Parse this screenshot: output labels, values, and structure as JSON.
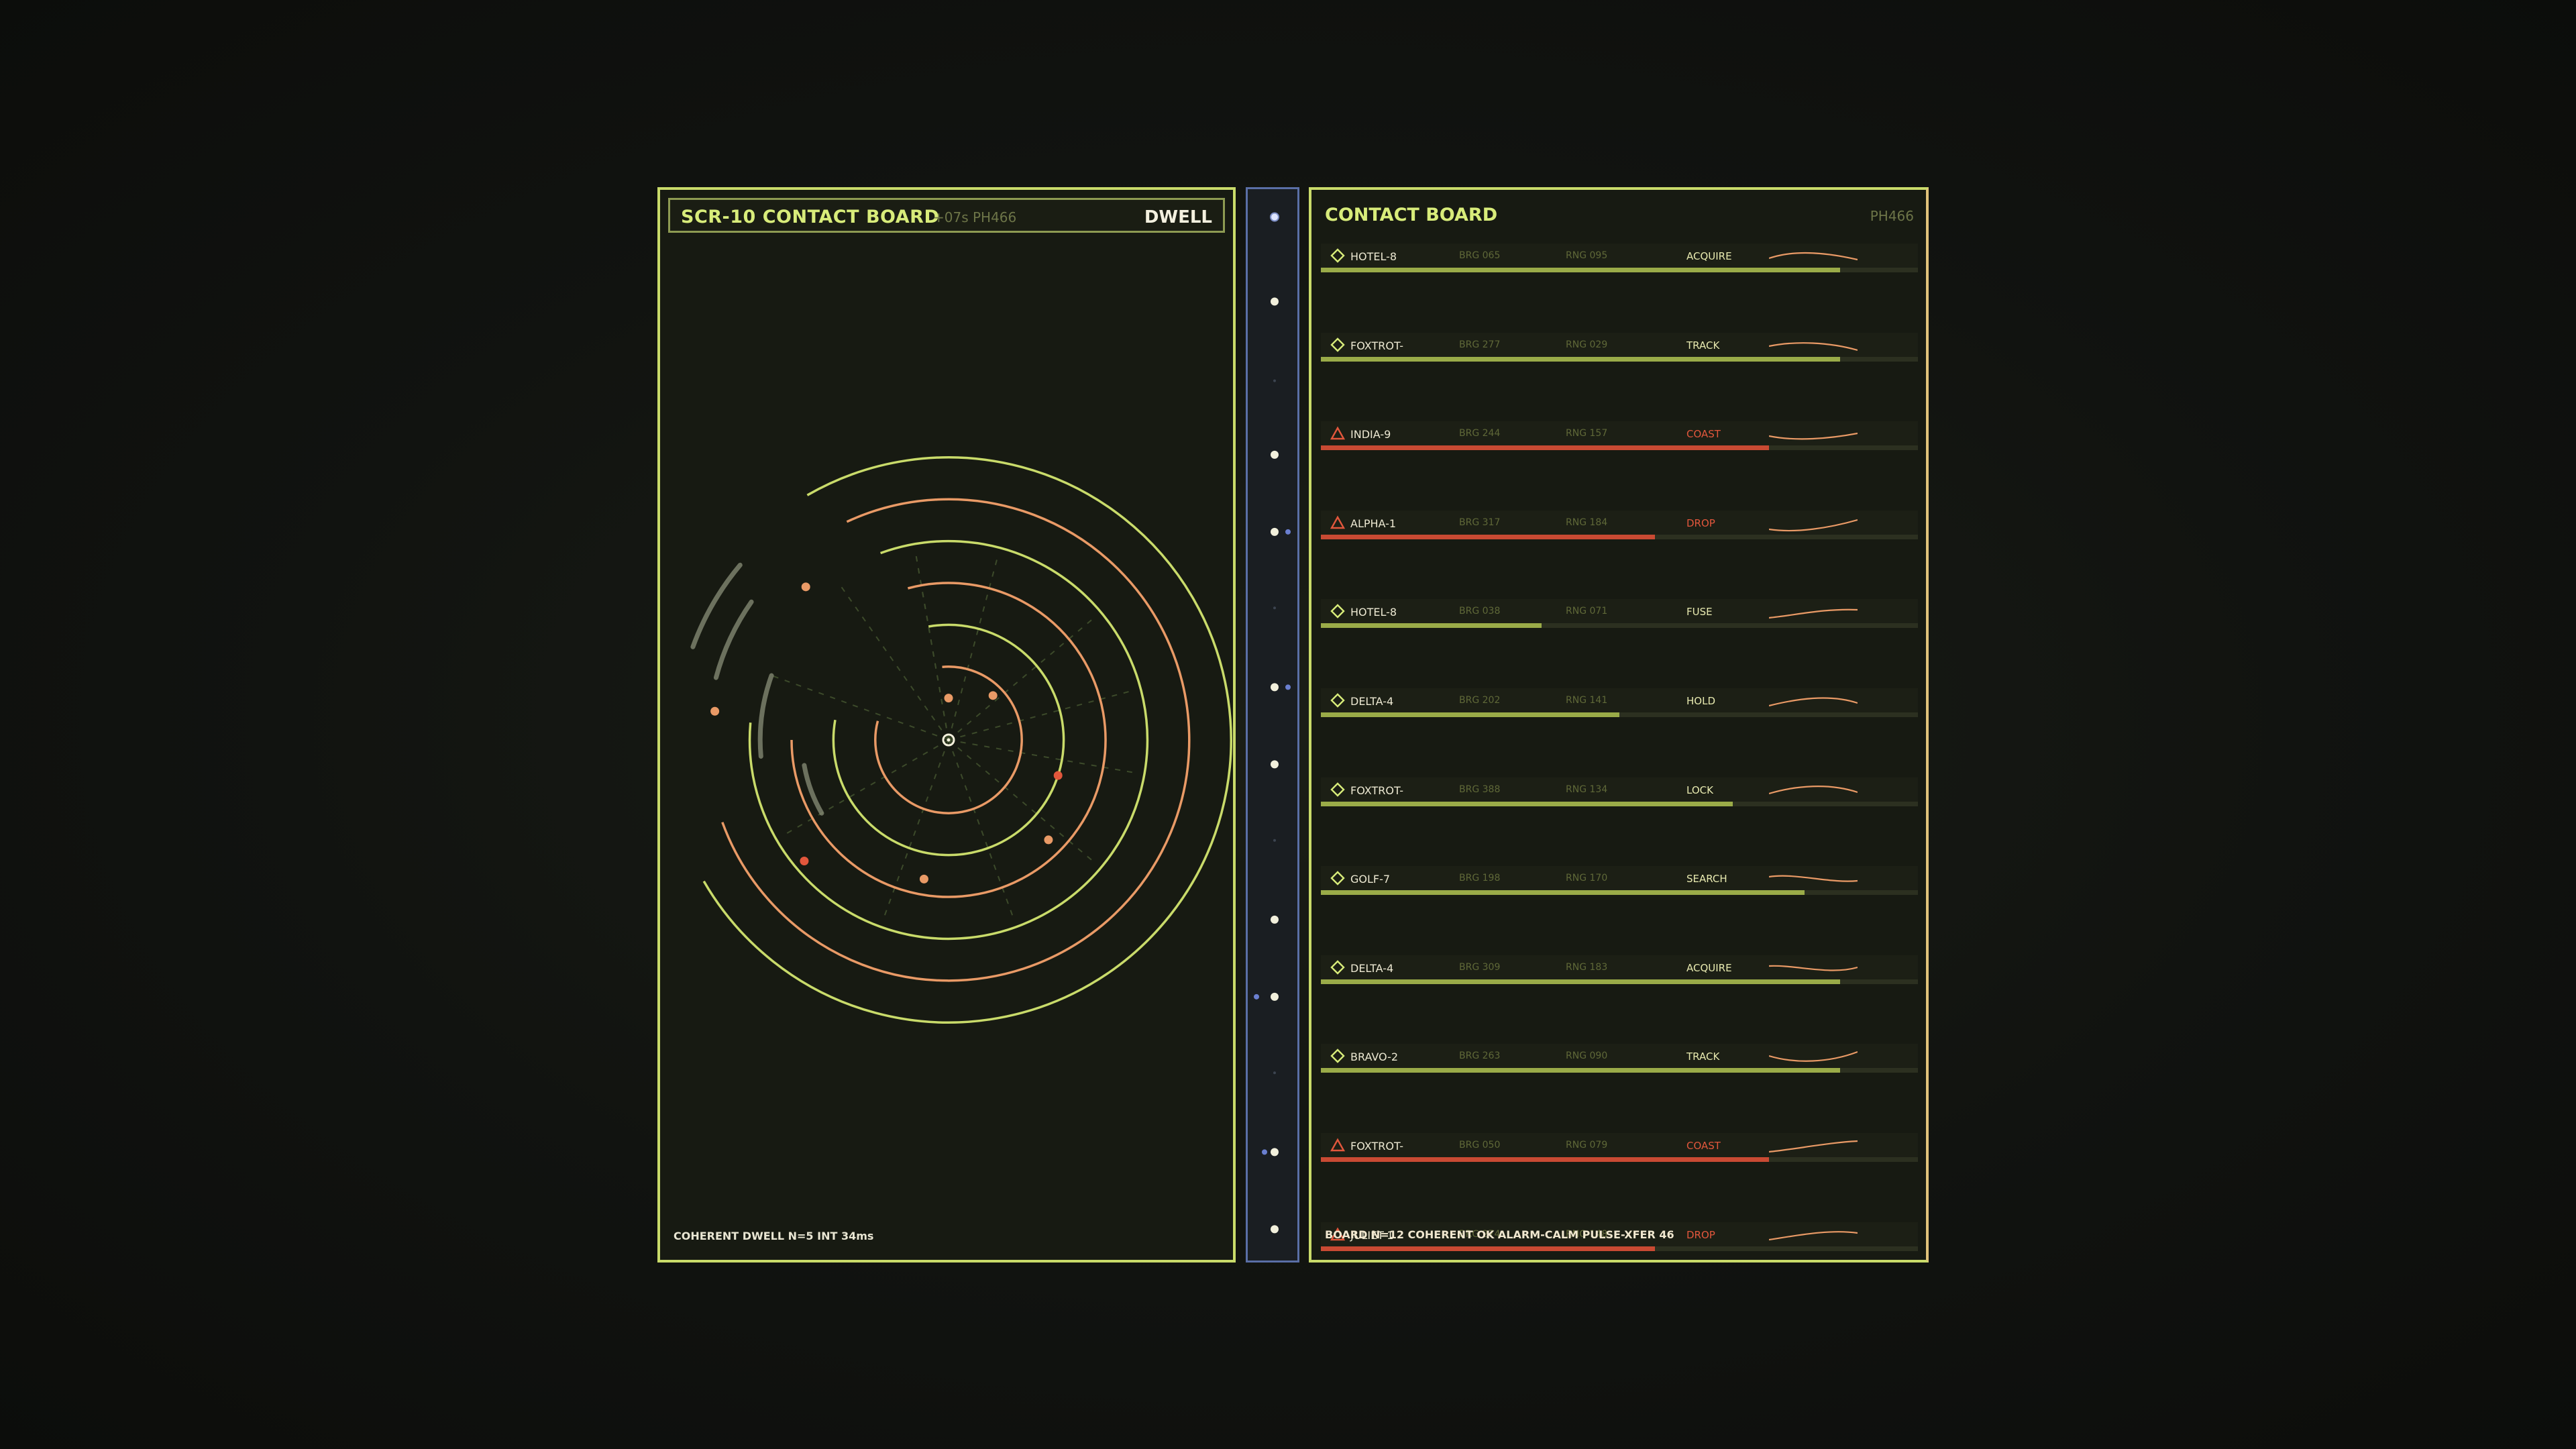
{
  "colors": {
    "accent": "#d8ec7a",
    "lime": "#c9db6a",
    "orange": "#e99a66",
    "red": "#e2573c",
    "blue": "#5a6fa6",
    "gray": "#8a8f78"
  },
  "left": {
    "title": "SCR-10  CONTACT BOARD",
    "title_sub": "+07s  PH466",
    "mode": "DWELL",
    "footer": "COHERENT DWELL  N=5  INT 34ms"
  },
  "right": {
    "title": "CONTACT BOARD",
    "code": "PH466",
    "footer": "BOARD N=12  COHERENT OK  ALARM-CALM  PULSE-XFER 46",
    "rows": [
      {
        "name": "HOTEL-8",
        "brg": "BRG 065",
        "rng": "RNG 095",
        "state": "ACQUIRE",
        "icon": "diamond",
        "alert": false,
        "level": 0.87
      },
      {
        "name": "FOXTROT-",
        "brg": "BRG 277",
        "rng": "RNG 029",
        "state": "TRACK",
        "icon": "diamond",
        "alert": false,
        "level": 0.87
      },
      {
        "name": "INDIA-9",
        "brg": "BRG 244",
        "rng": "RNG 157",
        "state": "COAST",
        "icon": "triangle",
        "alert": true,
        "level": 0.75
      },
      {
        "name": "ALPHA-1",
        "brg": "BRG 317",
        "rng": "RNG 184",
        "state": "DROP",
        "icon": "triangle",
        "alert": true,
        "level": 0.56
      },
      {
        "name": "HOTEL-8",
        "brg": "BRG 038",
        "rng": "RNG 071",
        "state": "FUSE",
        "icon": "diamond",
        "alert": false,
        "level": 0.37
      },
      {
        "name": "DELTA-4",
        "brg": "BRG 202",
        "rng": "RNG 141",
        "state": "HOLD",
        "icon": "diamond",
        "alert": false,
        "level": 0.5
      },
      {
        "name": "FOXTROT-",
        "brg": "BRG 388",
        "rng": "RNG 134",
        "state": "LOCK",
        "icon": "diamond",
        "alert": false,
        "level": 0.69
      },
      {
        "name": "GOLF-7",
        "brg": "BRG 198",
        "rng": "RNG 170",
        "state": "SEARCH",
        "icon": "diamond",
        "alert": false,
        "level": 0.81
      },
      {
        "name": "DELTA-4",
        "brg": "BRG 309",
        "rng": "RNG 183",
        "state": "ACQUIRE",
        "icon": "diamond",
        "alert": false,
        "level": 0.87
      },
      {
        "name": "BRAVO-2",
        "brg": "BRG 263",
        "rng": "RNG 090",
        "state": "TRACK",
        "icon": "diamond",
        "alert": false,
        "level": 0.87
      },
      {
        "name": "FOXTROT-",
        "brg": "BRG 050",
        "rng": "RNG 079",
        "state": "COAST",
        "icon": "triangle",
        "alert": true,
        "level": 0.75
      },
      {
        "name": "JULIET-1",
        "brg": "BRG 274",
        "rng": "RNG 148",
        "state": "DROP",
        "icon": "triangle",
        "alert": true,
        "level": 0.56
      }
    ]
  },
  "radar": {
    "rings": [
      {
        "radius": 0.14,
        "start": -95,
        "end": 195,
        "color": "orange"
      },
      {
        "radius": 0.22,
        "start": -100,
        "end": 190,
        "color": "lime"
      },
      {
        "radius": 0.3,
        "start": -105,
        "end": 180,
        "color": "orange"
      },
      {
        "radius": 0.38,
        "start": -110,
        "end": 185,
        "color": "lime"
      },
      {
        "radius": 0.46,
        "start": -115,
        "end": 160,
        "color": "orange"
      },
      {
        "radius": 0.54,
        "start": -120,
        "end": 150,
        "color": "lime"
      }
    ],
    "ghost_arcs": [
      {
        "radius": 0.52,
        "start": 200,
        "end": 220
      },
      {
        "radius": 0.46,
        "start": 195,
        "end": 215
      },
      {
        "radius": 0.36,
        "start": 175,
        "end": 200
      },
      {
        "radius": 0.28,
        "start": 150,
        "end": 170
      }
    ],
    "contacts": [
      {
        "angle": -90,
        "radius": 0.08,
        "color": "orange"
      },
      {
        "angle": -45,
        "radius": 0.12,
        "color": "orange"
      },
      {
        "angle": 18,
        "radius": 0.22,
        "color": "red"
      },
      {
        "angle": 45,
        "radius": 0.27,
        "color": "orange"
      },
      {
        "angle": 100,
        "radius": 0.27,
        "color": "orange"
      },
      {
        "angle": 140,
        "radius": 0.36,
        "color": "red"
      },
      {
        "angle": 187,
        "radius": 0.45,
        "color": "orange"
      },
      {
        "angle": 227,
        "radius": 0.4,
        "color": "orange"
      }
    ]
  },
  "strip": {
    "markers": [
      {
        "pos": 0.02,
        "kind": "ring"
      },
      {
        "pos": 0.1,
        "kind": "dot"
      },
      {
        "pos": 0.175,
        "kind": "faint"
      },
      {
        "pos": 0.245,
        "kind": "dot"
      },
      {
        "pos": 0.318,
        "kind": "dot-blue"
      },
      {
        "pos": 0.39,
        "kind": "faint"
      },
      {
        "pos": 0.465,
        "kind": "dot-blue"
      },
      {
        "pos": 0.538,
        "kind": "dot"
      },
      {
        "pos": 0.61,
        "kind": "faint"
      },
      {
        "pos": 0.685,
        "kind": "dot"
      },
      {
        "pos": 0.758,
        "kind": "dot-blue-left"
      },
      {
        "pos": 0.83,
        "kind": "faint"
      },
      {
        "pos": 0.905,
        "kind": "dot-blue-left2"
      },
      {
        "pos": 0.978,
        "kind": "dot"
      }
    ]
  }
}
